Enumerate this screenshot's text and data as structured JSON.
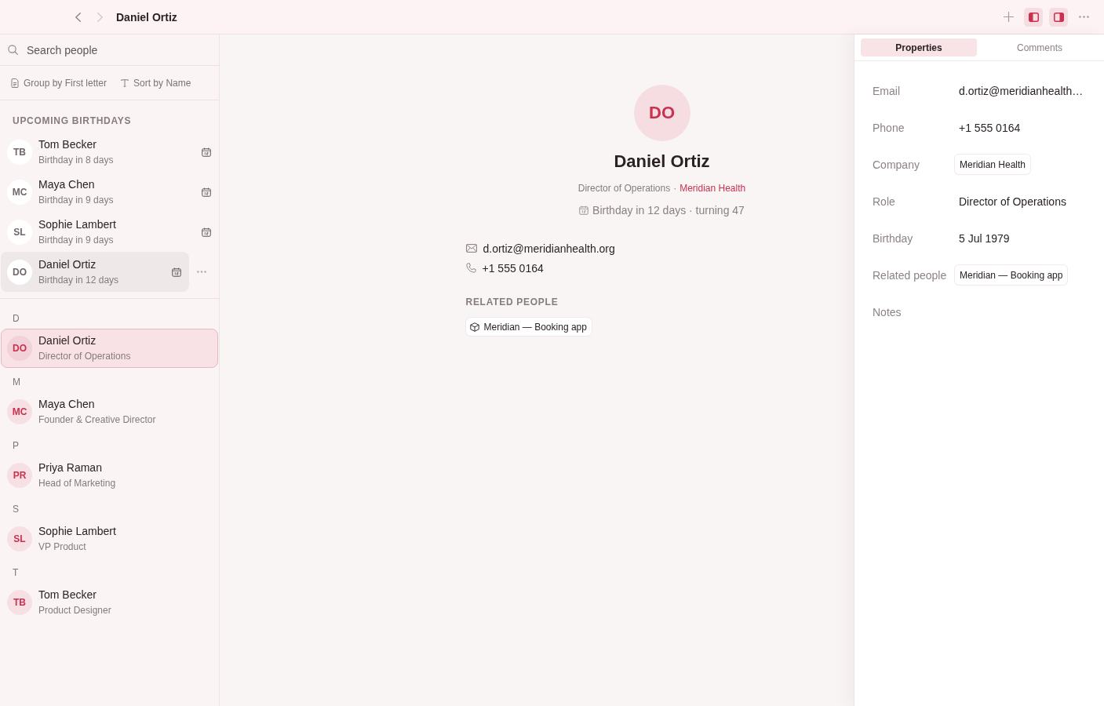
{
  "toolbar": {
    "nav": [
      {
        "kind": "back",
        "disabled": false
      },
      {
        "kind": "forward",
        "disabled": true
      }
    ],
    "title": "Daniel Ortiz",
    "actions": [
      {
        "kind": "add",
        "selected": false
      },
      {
        "kind": "left-panel",
        "selected": true
      },
      {
        "kind": "right-panel",
        "selected": true
      },
      {
        "kind": "more",
        "selected": false
      }
    ]
  },
  "sidebar": {
    "search": {
      "placeholder": "Search people"
    },
    "filters": [
      {
        "kind": "group",
        "label": "Group by First letter"
      },
      {
        "kind": "sort",
        "label": "Sort by Name"
      }
    ],
    "birthdays": {
      "heading": "UPCOMING BIRTHDAYS",
      "items": [
        {
          "initials": "TB",
          "name": "Tom Becker",
          "detail": "Birthday in 8 days",
          "hovered": false
        },
        {
          "initials": "MC",
          "name": "Maya Chen",
          "detail": "Birthday in 9 days",
          "hovered": false
        },
        {
          "initials": "SL",
          "name": "Sophie Lambert",
          "detail": "Birthday in 9 days",
          "hovered": false
        },
        {
          "initials": "DO",
          "name": "Daniel Ortiz",
          "detail": "Birthday in 12 days",
          "hovered": true
        }
      ]
    },
    "groups": [
      {
        "letter": "D",
        "people": [
          {
            "initials": "DO",
            "name": "Daniel Ortiz",
            "role": "Director of Operations",
            "selected": true
          }
        ]
      },
      {
        "letter": "M",
        "people": [
          {
            "initials": "MC",
            "name": "Maya Chen",
            "role": "Founder & Creative Director",
            "selected": false
          }
        ]
      },
      {
        "letter": "P",
        "people": [
          {
            "initials": "PR",
            "name": "Priya Raman",
            "role": "Head of Marketing",
            "selected": false
          }
        ]
      },
      {
        "letter": "S",
        "people": [
          {
            "initials": "SL",
            "name": "Sophie Lambert",
            "role": "VP Product",
            "selected": false
          }
        ]
      },
      {
        "letter": "T",
        "people": [
          {
            "initials": "TB",
            "name": "Tom Becker",
            "role": "Product Designer",
            "selected": false
          }
        ]
      }
    ]
  },
  "profile": {
    "initials": "DO",
    "name": "Daniel Ortiz",
    "role": "Director of Operations",
    "separator": "·",
    "company": "Meridian Health",
    "birthday": "Birthday in 12 days · turning 47",
    "contacts": [
      {
        "kind": "email",
        "value": "d.ortiz@meridianhealth.org"
      },
      {
        "kind": "phone",
        "value": "+1 555 0164"
      }
    ],
    "related_heading": "RELATED PEOPLE",
    "related": [
      {
        "label": "Meridian — Booking app"
      }
    ]
  },
  "inspector": {
    "tabs": [
      {
        "label": "Properties",
        "selected": true
      },
      {
        "label": "Comments",
        "selected": false
      }
    ],
    "properties": [
      {
        "label": "Email",
        "kind": "text",
        "value": "d.ortiz@meridianhealth…"
      },
      {
        "label": "Phone",
        "kind": "text",
        "value": "+1 555 0164"
      },
      {
        "label": "Company",
        "kind": "chip",
        "value": "Meridian Health"
      },
      {
        "label": "Role",
        "kind": "text",
        "value": "Director of Operations"
      },
      {
        "label": "Birthday",
        "kind": "text",
        "value": "5 Jul 1979"
      },
      {
        "label": "Related people",
        "kind": "chip",
        "value": "Meridian — Booking app"
      },
      {
        "label": "Notes",
        "kind": "empty"
      }
    ]
  }
}
